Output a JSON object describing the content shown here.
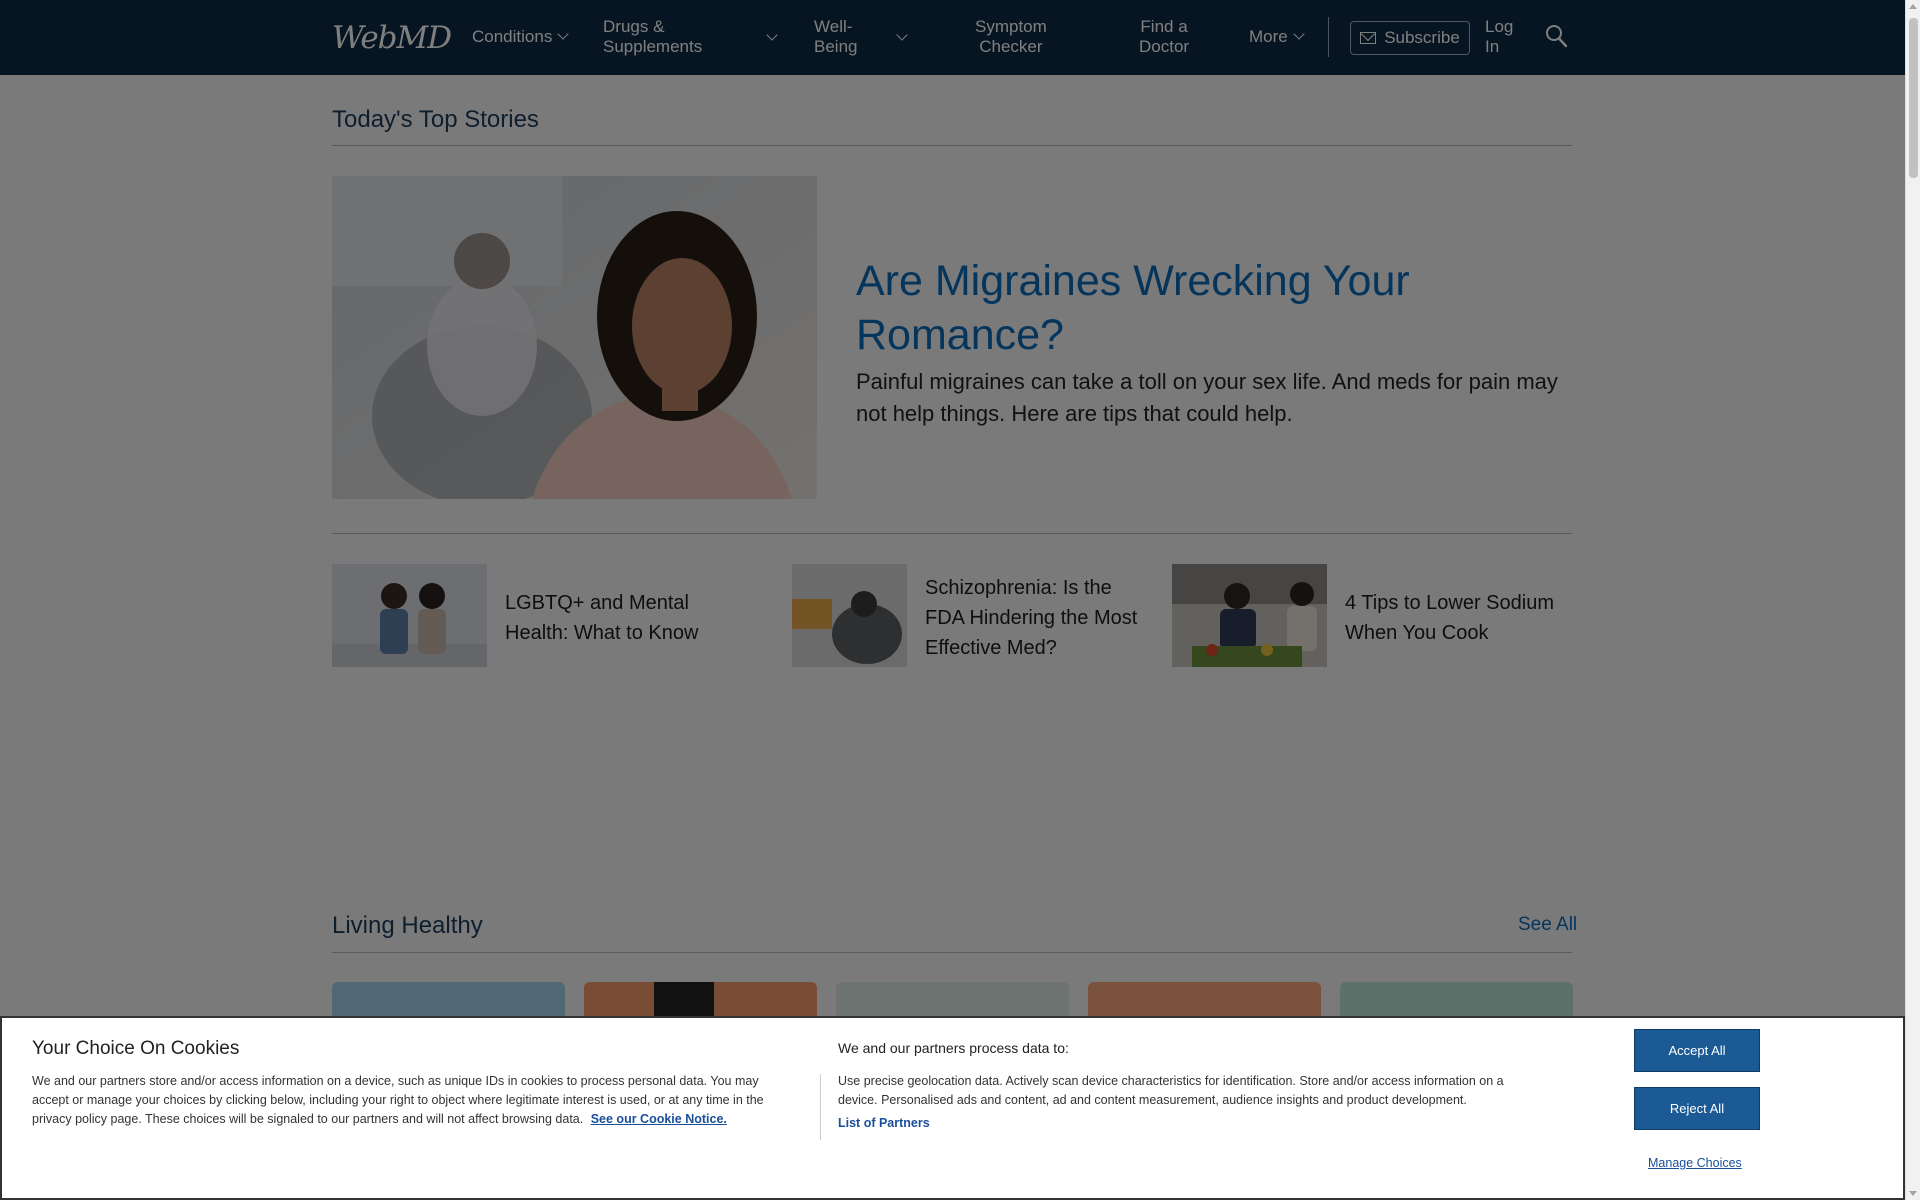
{
  "header": {
    "logo": "WebMD",
    "nav": {
      "conditions": "Conditions",
      "drugs_line1": "Drugs &",
      "drugs_line2": "Supplements",
      "wellbeing_line1": "Well-",
      "wellbeing_line2": "Being",
      "symptom_line1": "Symptom",
      "symptom_line2": "Checker",
      "doctor_line1": "Find a",
      "doctor_line2": "Doctor",
      "more": "More"
    },
    "subscribe": "Subscribe",
    "login_line1": "Log",
    "login_line2": "In"
  },
  "top_stories": {
    "section_title": "Today's Top Stories",
    "hero": {
      "title": "Are Migraines Wrecking Your Romance?",
      "description": "Painful migraines can take a toll on your sex life. And meds for pain may not help things. Here are tips that could help."
    },
    "stories": [
      {
        "title": "LGBTQ+ and Mental Health: What to Know"
      },
      {
        "title": "Schizophrenia: Is the FDA Hindering the Most Effective Med?"
      },
      {
        "title": "4 Tips to Lower Sodium When You Cook"
      }
    ]
  },
  "living_healthy": {
    "section_title": "Living Healthy",
    "see_all": "See All"
  },
  "cookie": {
    "title": "Your Choice On Cookies",
    "text": "We and our partners store and/or access information on a device, such as unique IDs in cookies to process personal data. You may accept or manage your choices by clicking below, including your right to object where legitimate interest is used, or at any time in the privacy policy page. These choices will be signaled to our partners and will not affect browsing data.",
    "notice_link": "See our Cookie Notice.",
    "process_title": "We and our partners process data to:",
    "purposes": "Use precise geolocation data. Actively scan device characteristics for identification. Store and/or access information on a device. Personalised ads and content, ad and content measurement, audience insights and product development.",
    "partners_link": "List of Partners",
    "accept": "Accept All",
    "reject": "Reject All",
    "manage": "Manage Choices"
  },
  "colors": {
    "header_bg": "#0f2a44",
    "link_blue": "#0d6bb8",
    "cookie_button": "#1b5a94"
  }
}
